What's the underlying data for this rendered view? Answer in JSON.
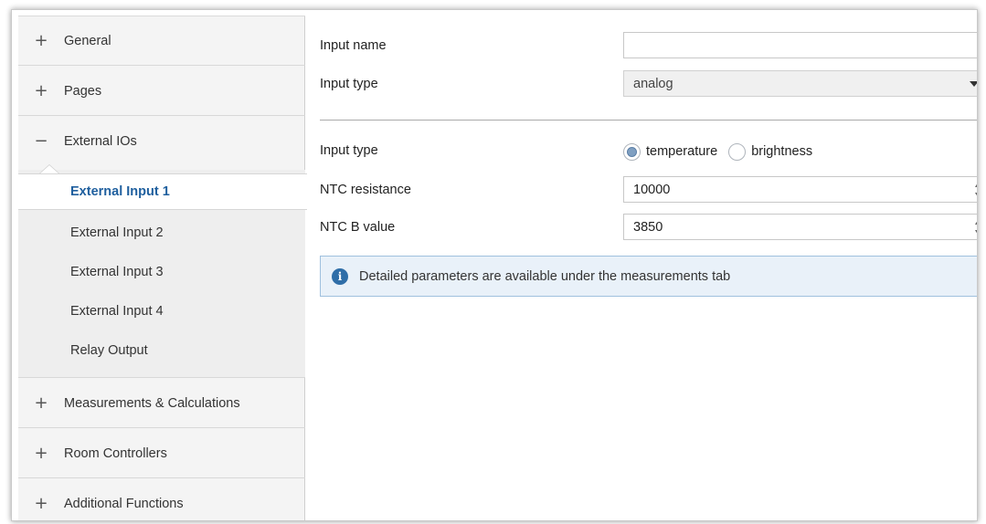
{
  "sidebar": {
    "items": [
      {
        "sign": "+",
        "label": "General"
      },
      {
        "sign": "+",
        "label": "Pages"
      },
      {
        "sign": "−",
        "label": "External IOs"
      },
      {
        "sign": "+",
        "label": "Measurements & Calculations"
      },
      {
        "sign": "+",
        "label": "Room Controllers"
      },
      {
        "sign": "+",
        "label": "Additional Functions"
      }
    ],
    "subitems": [
      {
        "label": "External Input 1",
        "active": true
      },
      {
        "label": "External Input 2",
        "active": false
      },
      {
        "label": "External Input 3",
        "active": false
      },
      {
        "label": "External Input 4",
        "active": false
      },
      {
        "label": "Relay Output",
        "active": false
      }
    ]
  },
  "form": {
    "input_name": {
      "label": "Input name",
      "value": ""
    },
    "input_type_select": {
      "label": "Input type",
      "value": "analog"
    },
    "input_type_radio": {
      "label": "Input type",
      "options": [
        {
          "label": "temperature",
          "selected": true
        },
        {
          "label": "brightness",
          "selected": false
        }
      ]
    },
    "ntc_resistance": {
      "label": "NTC resistance",
      "value": "10000"
    },
    "ntc_b_value": {
      "label": "NTC B value",
      "value": "3850"
    }
  },
  "info": {
    "icon": "info-icon",
    "text": "Detailed parameters are available under the measurements tab"
  },
  "colors": {
    "active_item": "#1f5f9e",
    "info_bg": "#e9f1f9",
    "info_border": "#9fc0de",
    "info_icon": "#2f6ea8"
  }
}
